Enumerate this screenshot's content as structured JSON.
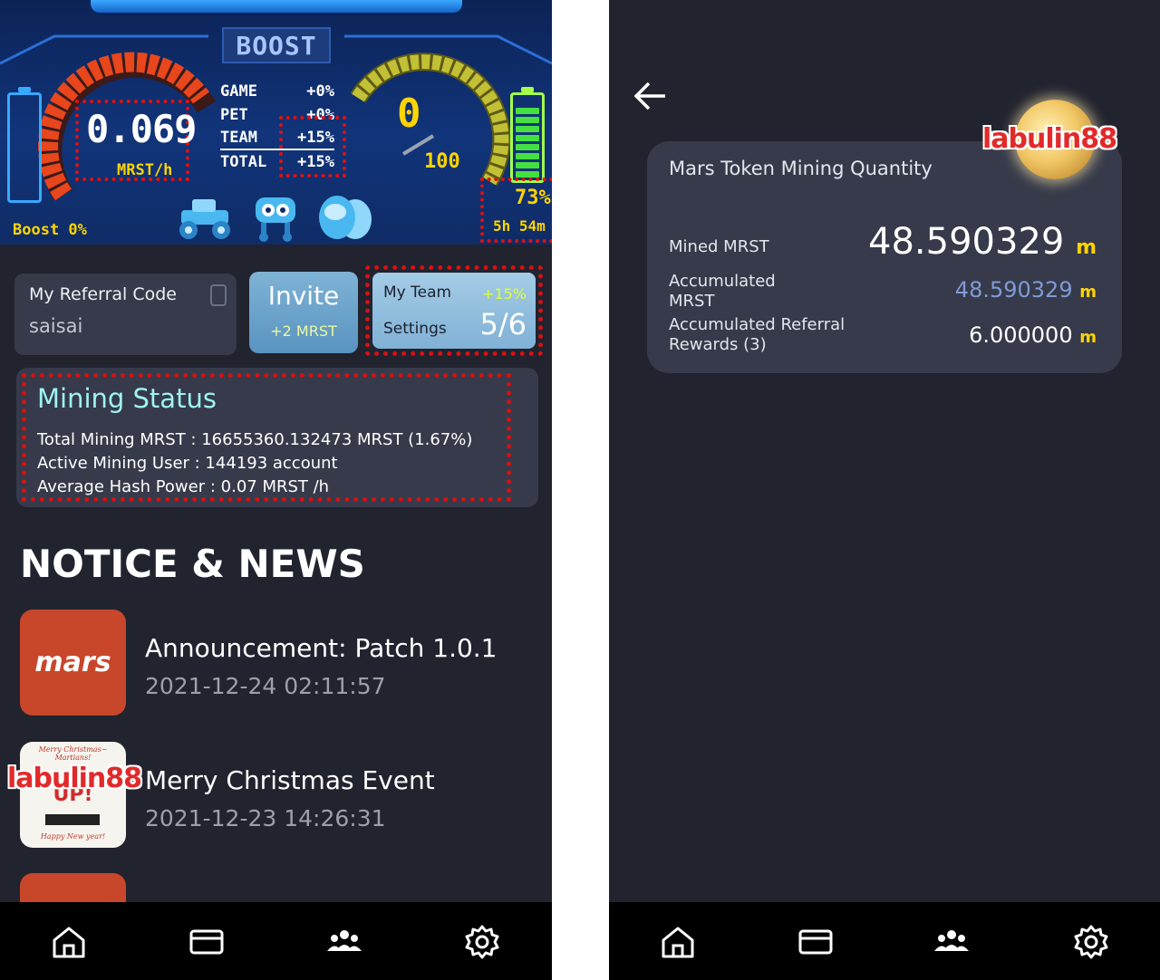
{
  "left": {
    "dashboard": {
      "title": "BOOST",
      "hash_rate": "0.069",
      "hash_unit": "MRST/h",
      "boost_rows": [
        {
          "label": "GAME",
          "value": "+0%"
        },
        {
          "label": "PET",
          "value": "+0%"
        },
        {
          "label": "TEAM",
          "value": "+15%"
        },
        {
          "label": "TOTAL",
          "value": "+15%"
        }
      ],
      "gauge_value": "0",
      "gauge_max": "100",
      "battery_percent": "73%",
      "battery_fill": 0.73,
      "time_left": "5h 54m",
      "boost_label": "Boost 0%"
    },
    "referral": {
      "title": "My Referral Code",
      "code": "saisai",
      "copy_icon": "copy-icon"
    },
    "invite": {
      "title": "Invite",
      "reward": "+2 MRST"
    },
    "team": {
      "title": "My Team",
      "bonus": "+15%",
      "settings": "Settings",
      "count": "5/6"
    },
    "mining_status": {
      "title": "Mining Status",
      "lines": [
        "Total Mining MRST : 16655360.132473 MRST (1.67%)",
        "Active Mining User : 144193 account",
        "Average Hash Power : 0.07 MRST /h"
      ]
    },
    "news": {
      "heading": "NOTICE & NEWS",
      "items": [
        {
          "thumb_text": "mars",
          "title": "Announcement: Patch 1.0.1",
          "date": "2021-12-24 02:11:57"
        },
        {
          "thumb_top": "Merry Christmas~ Martians!",
          "thumb_mid": "UP!",
          "thumb_bottom": "Happy New year!",
          "title": "Merry Christmas Event",
          "date": "2021-12-23 14:26:31"
        }
      ]
    },
    "nav": [
      "home-icon",
      "wallet-icon",
      "team-icon",
      "settings-icon"
    ],
    "watermark": "labulin88"
  },
  "right": {
    "back_icon": "back-arrow-icon",
    "card": {
      "title": "Mars Token Mining Quantity",
      "rows": [
        {
          "label": "Mined MRST",
          "value": "48.590329"
        },
        {
          "label_line1": "Accumulated",
          "label_line2": "MRST",
          "value": "48.590329"
        },
        {
          "label_line1": "Accumulated Referral",
          "label_line2": "Rewards (3)",
          "value": "6.000000"
        }
      ],
      "unit_symbol": "m",
      "value_color_secondary": "#7f9bd6"
    },
    "watermark": "labulin88",
    "nav": [
      "home-icon",
      "wallet-icon",
      "team-icon",
      "settings-icon"
    ]
  },
  "colors": {
    "background": "#21232f",
    "card": "#363a4a",
    "highlight": "#d71010",
    "accent_yellow": "#ffd400",
    "cyan": "#9ef3f3"
  }
}
